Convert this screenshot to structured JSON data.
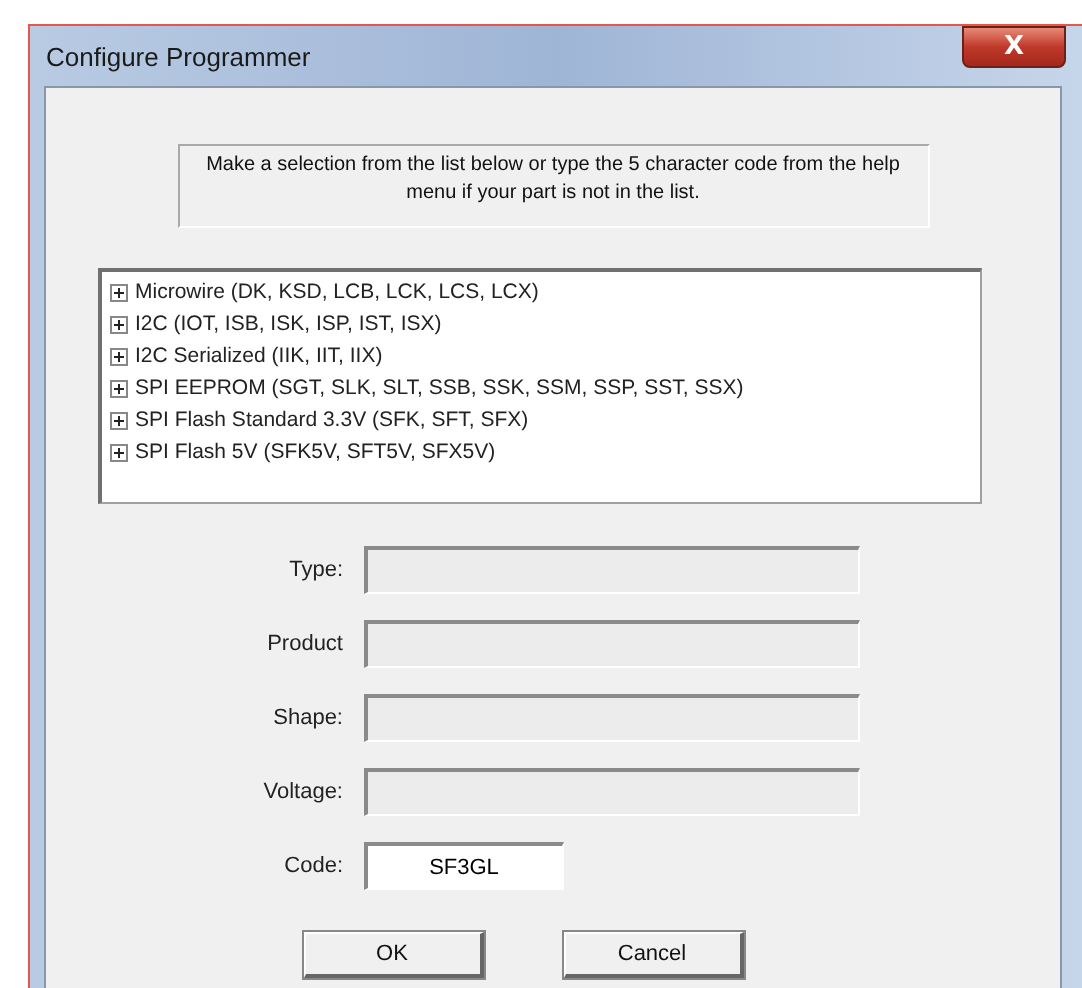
{
  "window": {
    "title": "Configure Programmer",
    "close_button": "X"
  },
  "instructions": "Make a selection from the list below or type the 5 character code from the help menu if your part is not in the list.",
  "tree": {
    "items": [
      {
        "label": "Microwire (DK, KSD, LCB, LCK, LCS, LCX)",
        "expanded": false
      },
      {
        "label": "I2C (IOT, ISB, ISK, ISP, IST, ISX)",
        "expanded": false
      },
      {
        "label": "I2C Serialized (IIK, IIT, IIX)",
        "expanded": false
      },
      {
        "label": "SPI EEPROM (SGT, SLK, SLT, SSB, SSK, SSM, SSP, SST, SSX)",
        "expanded": false
      },
      {
        "label": "SPI Flash Standard 3.3V (SFK, SFT, SFX)",
        "expanded": false
      },
      {
        "label": "SPI Flash 5V (SFK5V, SFT5V, SFX5V)",
        "expanded": false
      }
    ]
  },
  "fields": [
    {
      "label": "Type:",
      "disabled": true
    },
    {
      "label": "Product",
      "disabled": true
    },
    {
      "label": "Shape:",
      "disabled": true
    },
    {
      "label": "Voltage:",
      "disabled": true
    },
    {
      "label": "Code:",
      "value": "SF3GL",
      "disabled": false
    }
  ],
  "buttons": [
    "OK",
    "Cancel"
  ]
}
